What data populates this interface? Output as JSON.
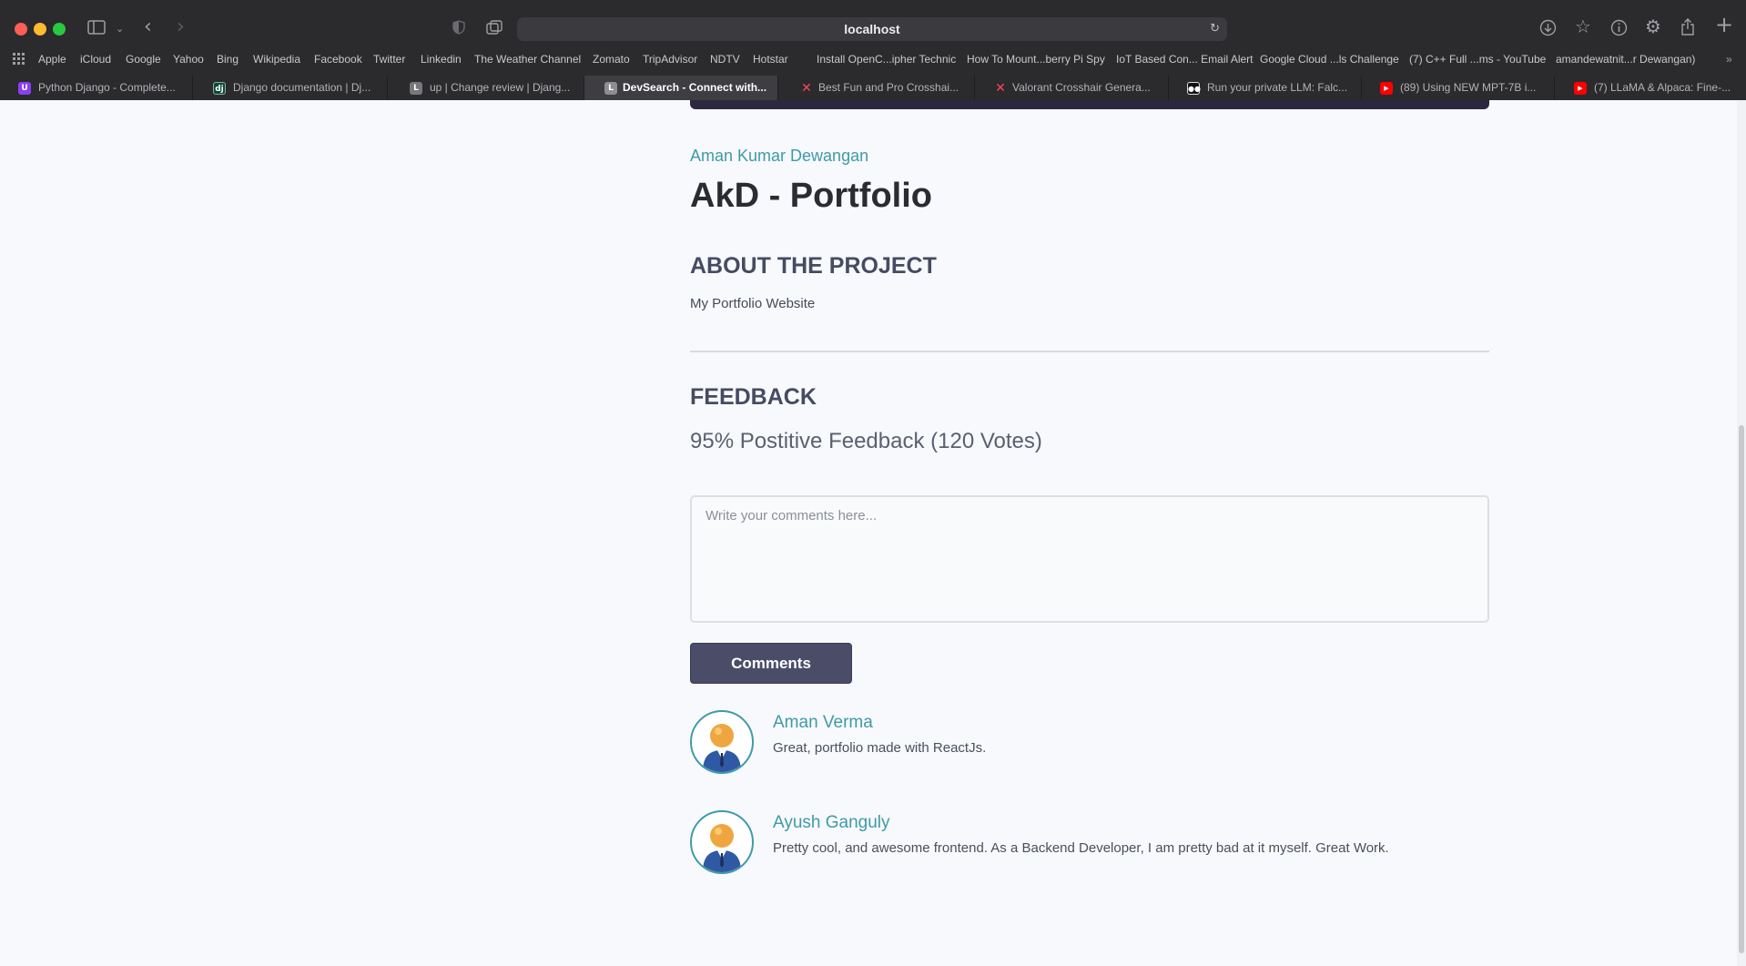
{
  "browser": {
    "url": "localhost",
    "bookmarks": [
      "Apple",
      "iCloud",
      "Google",
      "Yahoo",
      "Bing",
      "Wikipedia",
      "Facebook",
      "Twitter",
      "Linkedin",
      "The Weather Channel",
      "Zomato",
      "TripAdvisor",
      "NDTV",
      "Hotstar",
      "Install OpenC...ipher Technic",
      "How To Mount...berry Pi Spy",
      "IoT Based Con... Email Alert",
      "Google Cloud ...ls Challenge",
      "(7) C++ Full ...ms - YouTube",
      "amandewatnit...r Dewangan)"
    ],
    "tabs": [
      {
        "title": "Python Django - Complete...",
        "icon": "udemy-icon"
      },
      {
        "title": "Django documentation | Dj...",
        "icon": "django-icon"
      },
      {
        "title": "up | Change review | Djang...",
        "icon": "letter-l-icon"
      },
      {
        "title": "DevSearch - Connect with...",
        "icon": "letter-l-icon",
        "active": true
      },
      {
        "title": "Best Fun and Pro Crosshai...",
        "icon": "valorant-icon"
      },
      {
        "title": "Valorant Crosshair Genera...",
        "icon": "valorant-icon"
      },
      {
        "title": "Run your private LLM: Falc...",
        "icon": "medium-icon"
      },
      {
        "title": "(89) Using NEW MPT-7B i...",
        "icon": "youtube-icon"
      },
      {
        "title": "(7) LLaMA & Alpaca: Fine-...",
        "icon": "youtube-icon"
      }
    ]
  },
  "project": {
    "author": "Aman Kumar Dewangan",
    "title": "AkD - Portfolio",
    "about_heading": "ABOUT THE PROJECT",
    "about_text": "My Portfolio Website"
  },
  "feedback": {
    "heading": "FEEDBACK",
    "stats": "95% Postitive Feedback (120 Votes)",
    "comment_placeholder": "Write your comments here...",
    "submit_label": "Comments"
  },
  "reviews": [
    {
      "name": "Aman Verma",
      "text": "Great, portfolio made with ReactJs."
    },
    {
      "name": "Ayush Ganguly",
      "text": "Pretty cool, and awesome frontend. As a Backend Developer, I am pretty bad at it myself. Great Work."
    }
  ],
  "colors": {
    "accent": "#3f9aa8",
    "button": "#4b4d68",
    "heading": "#464b62",
    "page_bg": "#f7f9fc"
  }
}
